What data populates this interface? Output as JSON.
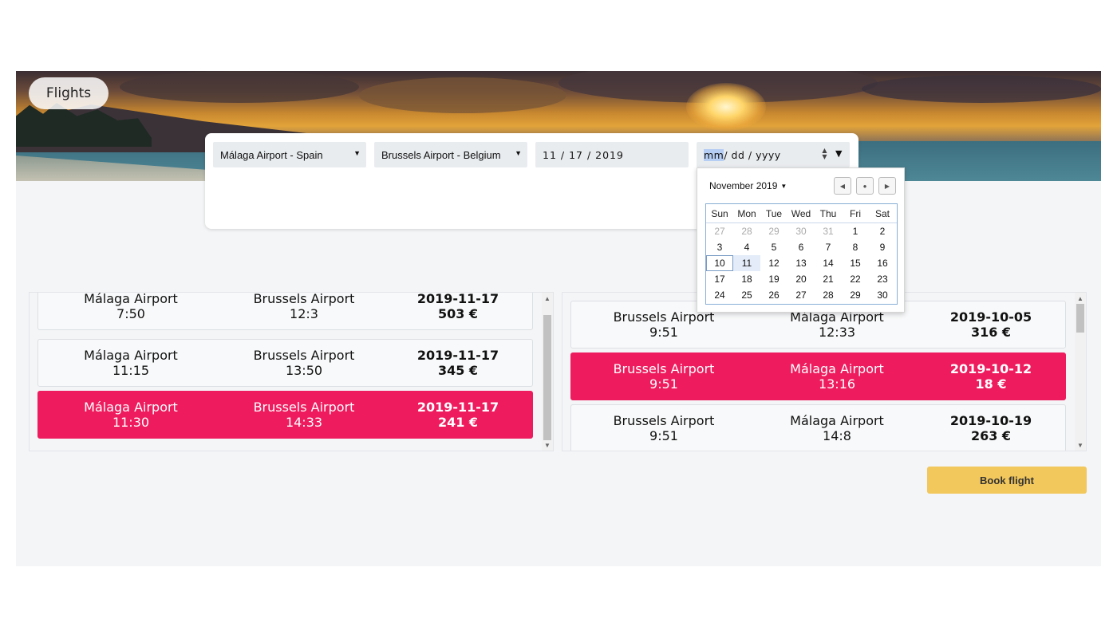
{
  "header": {
    "title": "Flights"
  },
  "search": {
    "origin": "Málaga Airport - Spain",
    "destination": "Brussels Airport - Belgium",
    "depart_date": "11 / 17 / 2019",
    "return_date": {
      "mm": "mm",
      "rest": " / dd / yyyy"
    }
  },
  "outbound": [
    {
      "from": "Málaga Airport",
      "dep": "7:50",
      "to": "Brussels Airport",
      "arr": "12:3",
      "date": "2019-11-17",
      "price": "503 €",
      "selected": false
    },
    {
      "from": "Málaga Airport",
      "dep": "11:15",
      "to": "Brussels Airport",
      "arr": "13:50",
      "date": "2019-11-17",
      "price": "345 €",
      "selected": false
    },
    {
      "from": "Málaga Airport",
      "dep": "11:30",
      "to": "Brussels Airport",
      "arr": "14:33",
      "date": "2019-11-17",
      "price": "241 €",
      "selected": true
    }
  ],
  "inbound": [
    {
      "from": "Brussels Airport",
      "dep": "9:51",
      "to": "Málaga Airport",
      "arr": "12:33",
      "date": "2019-10-05",
      "price": "316 €",
      "selected": false
    },
    {
      "from": "Brussels Airport",
      "dep": "9:51",
      "to": "Málaga Airport",
      "arr": "13:16",
      "date": "2019-10-12",
      "price": "18 €",
      "selected": true
    },
    {
      "from": "Brussels Airport",
      "dep": "9:51",
      "to": "Málaga Airport",
      "arr": "14:8",
      "date": "2019-10-19",
      "price": "263 €",
      "selected": false
    }
  ],
  "actions": {
    "book_label": "Book flight"
  },
  "calendar": {
    "month_label": "November 2019",
    "weekdays": [
      "Sun",
      "Mon",
      "Tue",
      "Wed",
      "Thu",
      "Fri",
      "Sat"
    ],
    "weeks": [
      [
        "27",
        "28",
        "29",
        "30",
        "31",
        "1",
        "2"
      ],
      [
        "3",
        "4",
        "5",
        "6",
        "7",
        "8",
        "9"
      ],
      [
        "10",
        "11",
        "12",
        "13",
        "14",
        "15",
        "16"
      ],
      [
        "17",
        "18",
        "19",
        "20",
        "21",
        "22",
        "23"
      ],
      [
        "24",
        "25",
        "26",
        "27",
        "28",
        "29",
        "30"
      ]
    ],
    "leading_muted": 5,
    "today": "10",
    "hovered": "11"
  },
  "colors": {
    "selected": "#ee1c5e",
    "book_button": "#f2c75c",
    "background": "#f4f5f7"
  }
}
